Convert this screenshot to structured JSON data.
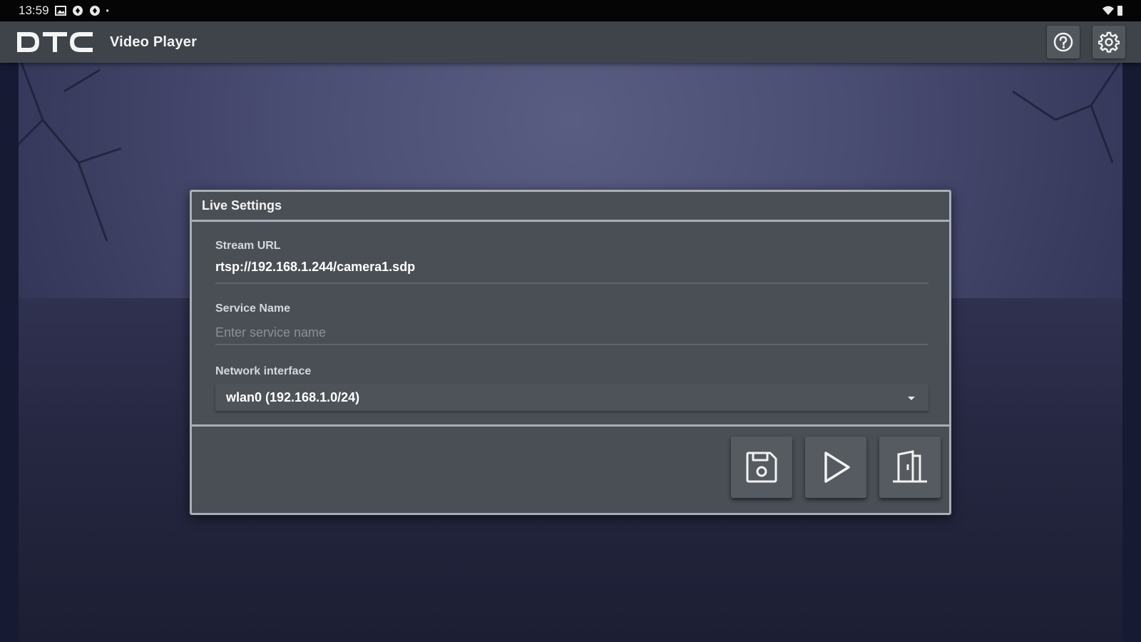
{
  "status_bar": {
    "time": "13:59",
    "icons": [
      "image-icon",
      "vpn-icon",
      "vpn-icon",
      "dot-icon",
      "wifi-icon",
      "battery-icon"
    ]
  },
  "app_bar": {
    "logo_text": "DTC",
    "title": "Video Player",
    "actions": [
      "help-icon",
      "settings-icon"
    ]
  },
  "dialog": {
    "title": "Live Settings",
    "stream_url": {
      "label": "Stream URL",
      "value": "rtsp://192.168.1.244/camera1.sdp"
    },
    "service_name": {
      "label": "Service Name",
      "value": "",
      "placeholder": "Enter service name"
    },
    "network_interface": {
      "label": "Network interface",
      "selected": "wlan0 (192.168.1.0/24)"
    },
    "buttons": [
      "save-icon",
      "play-icon",
      "exit-door-icon"
    ]
  },
  "colors": {
    "app_bar": "#3f444a",
    "dialog_bg": "#4a4f55",
    "dialog_border": "#a9afb6",
    "backdrop": "#4a4d72"
  }
}
